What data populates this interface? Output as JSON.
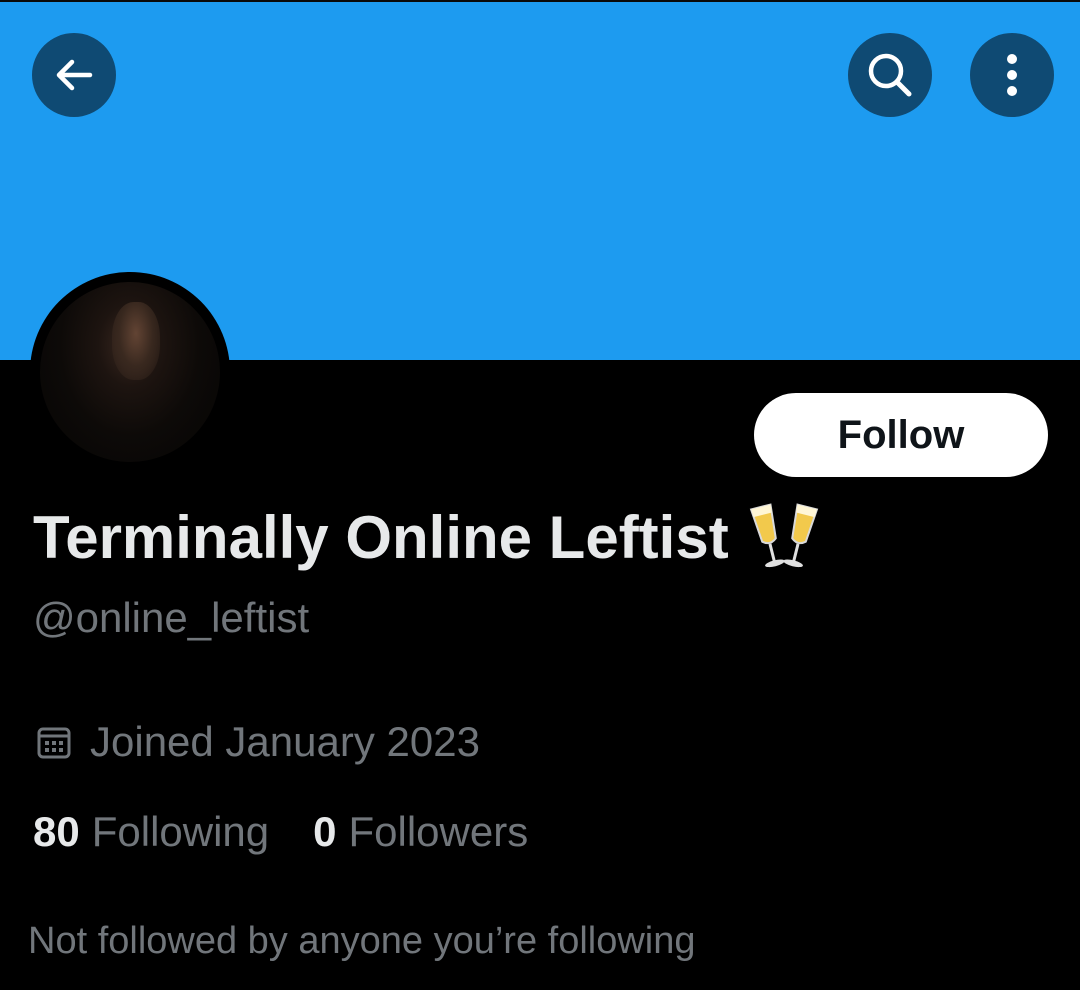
{
  "colors": {
    "banner": "#1d9bf0",
    "background": "#000000",
    "circle_button": "#0f4a73",
    "primary_text": "#e7e9ea",
    "secondary_text": "#71767b",
    "follow_button_bg": "#ffffff",
    "follow_button_text": "#0f1419"
  },
  "header": {
    "back_icon": "arrow-left-icon",
    "search_icon": "search-icon",
    "more_icon": "more-vertical-icon"
  },
  "profile": {
    "display_name": "Terminally Online Leftist",
    "name_emoji": "clinking-glasses-icon",
    "handle": "@online_leftist",
    "joined_icon": "calendar-icon",
    "joined": "Joined January 2023",
    "following_count": "80",
    "following_label": "Following",
    "followers_count": "0",
    "followers_label": "Followers",
    "mutuals_text": "Not followed by anyone you’re following"
  },
  "actions": {
    "follow_label": "Follow"
  }
}
